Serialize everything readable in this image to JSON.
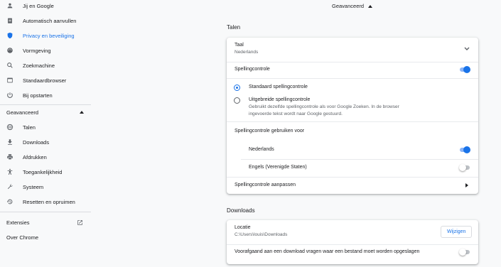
{
  "sidebar": {
    "items": [
      {
        "label": "Jij en Google",
        "icon": "person-icon"
      },
      {
        "label": "Automatisch aanvullen",
        "icon": "clipboard-icon"
      },
      {
        "label": "Privacy en beveiliging",
        "icon": "shield-icon",
        "active": true
      },
      {
        "label": "Vormgeving",
        "icon": "palette-icon"
      },
      {
        "label": "Zoekmachine",
        "icon": "search-icon"
      },
      {
        "label": "Standaardbrowser",
        "icon": "browser-icon"
      },
      {
        "label": "Bij opstarten",
        "icon": "power-icon"
      }
    ],
    "advanced_label": "Geavanceerd",
    "advanced_items": [
      {
        "label": "Talen",
        "icon": "globe-icon"
      },
      {
        "label": "Downloads",
        "icon": "download-icon"
      },
      {
        "label": "Afdrukken",
        "icon": "printer-icon"
      },
      {
        "label": "Toegankelijkheid",
        "icon": "accessibility-icon"
      },
      {
        "label": "Systeem",
        "icon": "wrench-icon"
      },
      {
        "label": "Resetten en opruimen",
        "icon": "history-icon"
      }
    ],
    "extensions_label": "Extensies",
    "about_label": "Over Chrome"
  },
  "main": {
    "advanced_header": "Geavanceerd",
    "languages": {
      "title": "Talen",
      "language_label": "Taal",
      "language_value": "Nederlands",
      "spellcheck_label": "Spellingcontrole",
      "spellcheck_on": true,
      "standard_label": "Standaard spellingcontrole",
      "enhanced_label": "Uitgebreide spellingcontrole",
      "enhanced_desc_line1": "Gebruikt dezelfde spellingcontrole als voor Google Zoeken. In de browser",
      "enhanced_desc_line2": "ingevoerde tekst wordt naar Google gestuurd.",
      "use_for_label": "Spellingcontrole gebruiken voor",
      "lang1": "Nederlands",
      "lang1_on": true,
      "lang2": "Engels (Verenigde Staten)",
      "lang2_on": false,
      "customize_label": "Spellingcontrole aanpassen"
    },
    "downloads": {
      "title": "Downloads",
      "location_label": "Locatie",
      "location_value": "C:\\Users\\louis\\Downloads",
      "change_button": "Wijzigen",
      "ask_label": "Voorafgaand aan een download vragen waar een bestand moet worden opgeslagen",
      "ask_on": false
    }
  },
  "colors": {
    "accent": "#1a73e8",
    "text": "#202124",
    "secondary": "#5f6368",
    "background": "#f8f9fa"
  }
}
